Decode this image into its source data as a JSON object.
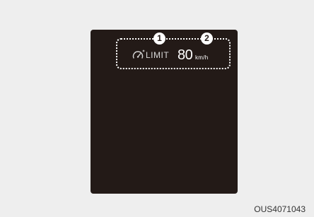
{
  "callouts": [
    "1",
    "2"
  ],
  "display": {
    "limit_icon": "speed-limit-icon",
    "limit_label": "LIMIT",
    "speed_value": "80",
    "speed_unit": "km/h"
  },
  "figure_code": "OUS4071043",
  "colors": {
    "display_background": "#231a17",
    "page_background": "#eeeeee",
    "highlight": "#ffffff"
  }
}
